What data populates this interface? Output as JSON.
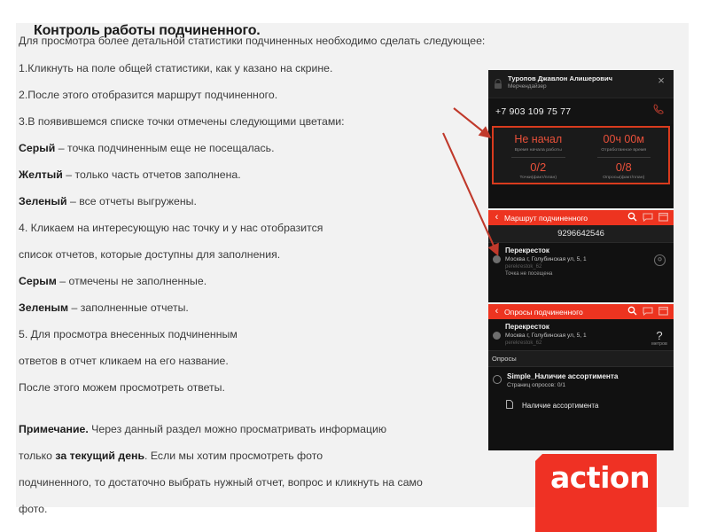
{
  "document": {
    "title": "Контроль работы подчиненного.",
    "intro": "Для просмотра более детальной статистики подчиненных необходимо сделать следующее:",
    "steps": [
      "1.Кликнуть на поле общей статистики, как у казано на скрине.",
      "2.После этого отобразится маршрут подчиненного.",
      "3.В появившемся списке точки отмечены следующими цветами:"
    ],
    "legend": [
      {
        "term": "Серый",
        "rest": " – точка подчиненным еще не посещалась."
      },
      {
        "term": "Желтый",
        "rest": " – только часть отчетов заполнена."
      },
      {
        "term": "Зеленый",
        "rest": " – все отчеты выгружены."
      }
    ],
    "step4_line1": "4. Кликаем на интересующую нас точку и у нас отобразится",
    "step4_line2": "список отчетов, которые доступны для заполнения.",
    "legend2": [
      {
        "term": "Серым",
        "rest": " – отмечены не заполненные."
      },
      {
        "term": "Зеленым",
        "rest": " – заполненные отчеты."
      }
    ],
    "step5_line1": "5. Для просмотра внесенных подчиненным",
    "step5_line2": "ответов в отчет кликаем на его название.",
    "step5_line3": "После этого можем просмотреть ответы.",
    "note": {
      "label": "Примечание.",
      "line1_rest": " Через данный раздел можно просматривать информацию",
      "line2_pre": "только ",
      "line2_bold": "за текущий день",
      "line2_post": ". Если мы хотим просмотреть фото",
      "line3": "подчиненного, то достаточно выбрать нужный отчет, вопрос и кликнуть на само",
      "line4": "фото."
    }
  },
  "phone_profile": {
    "employee_name": "Туропов Джавлон Алишерович",
    "employee_role": "Мерчендайзер",
    "close_label": "×",
    "phone_number": "+7 903 109 75 77",
    "stats": [
      {
        "value": "Не начал",
        "label": "Время начала работы"
      },
      {
        "value": "00ч 00м",
        "label": "Отработанное время"
      },
      {
        "value": "0/2",
        "label": "Точки(факт/план)"
      },
      {
        "value": "0/8",
        "label": "Опросы(факт/план)"
      }
    ]
  },
  "phone_route": {
    "back_label": "‹",
    "title": "Маршрут подчиненного",
    "route_number": "9296642546",
    "point": {
      "name": "Перекресток",
      "address": "Москва г, Голубинская ул, 5, 1",
      "code": "perekrestok_62",
      "status": "Точка не посещена"
    }
  },
  "phone_polls": {
    "back_label": "‹",
    "title": "Опросы подчиненного",
    "point": {
      "name": "Перекресток",
      "address": "Москва г, Голубинская ул, 5, 1",
      "code": "perekrestok_62",
      "distance_value": "?",
      "distance_label": "метров"
    },
    "section_label": "Опросы",
    "poll": {
      "name": "Simple_Наличие ассортимента",
      "pages": "Страниц опросов: 0/1",
      "sub_item": "Наличие ассортимента"
    }
  },
  "logo": {
    "text": "action"
  },
  "colors": {
    "brand_red": "#ef3124",
    "bar_red": "#ed3420",
    "arrow_red": "#c0392b",
    "stat_red": "#e8503a",
    "page_bg": "#f2f2f2",
    "phone_bg": "#111111"
  }
}
